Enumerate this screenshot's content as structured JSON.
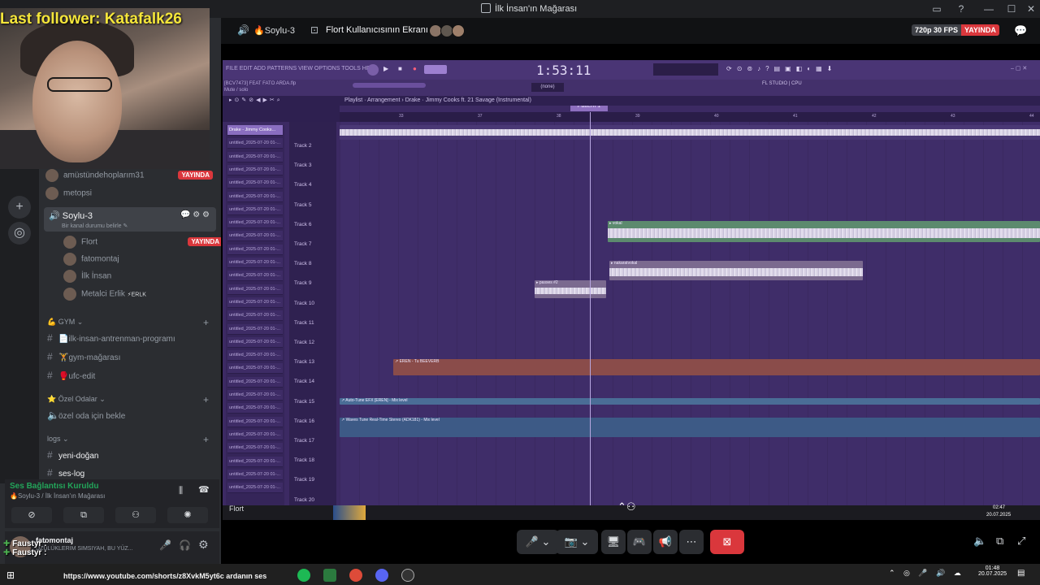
{
  "window": {
    "title": "İlk İnsan'ın Mağarası",
    "buttons": [
      "▭",
      "?",
      "—",
      "☐",
      "✕"
    ]
  },
  "overlay": {
    "last_follower": "Last follower: Katafalk26",
    "chat_lines": [
      "Faustyr : ",
      "Faustyr : "
    ]
  },
  "voice_channel": {
    "members_top": [
      {
        "name": "amüstündehoplarım31",
        "live": "YAYINDA"
      },
      {
        "name": "metopsi",
        "live": ""
      }
    ],
    "channel_name": "🔊 Soylu-3",
    "channel_status": "Bir kanal durumu belirle ✎",
    "members": [
      {
        "name": "Flort",
        "live": "YAYINDA"
      },
      {
        "name": "fatomontaj",
        "live": ""
      },
      {
        "name": "İlk İnsan",
        "live": ""
      },
      {
        "name": "Metalci Erlik",
        "tag": "⚡ERLK",
        "live": ""
      }
    ]
  },
  "categories": {
    "gym": "💪 GYM ⌄",
    "gym_channels": [
      "📄ilk-insan-antrenman-programı",
      "🏋gym-mağarası",
      "🥊ufc-edit"
    ],
    "private": "⭐ Özel Odalar ⌄",
    "private_channels": [
      "özel oda için bekle"
    ],
    "logs": "logs ⌄",
    "logs_channels": [
      "yeni-doğan",
      "ses-log"
    ]
  },
  "voice_status": {
    "connected": "Ses Bağlantısı Kuruldu",
    "location": "🔥Soylu-3 / İlk İnsan'ın Mağarası"
  },
  "user_panel": {
    "name": "fatomontaj",
    "status": "ÜZÜLÜKLERIM SIMSIYAH, BU YÜZ..."
  },
  "stream_header": {
    "channel": "🔥Soylu-3",
    "share": "Flort Kullanıcısının Ekranı",
    "quality": "720p 30 FPS",
    "live": "YAYINDA"
  },
  "fl_studio": {
    "menu": "FILE  EDIT  ADD  PATTERNS  VIEW  OPTIONS  TOOLS  HELP",
    "time": "1:53:11",
    "project": "[BCV7473] FEAT FATO ARDA.flp",
    "project_sub": "Mute / solo",
    "pattern": "Pattern 1",
    "cpu": "FL STUDIO | CPU",
    "breadcrumb": "Playlist · Arrangement › Drake · Jimmy Cooks ft. 21 Savage (Instrumental)",
    "browser_first": "Drake - Jimmy Cooks...",
    "browser_item": "untitled_2025-07-20 01-...",
    "tracks": [
      "Track 2",
      "Track 3",
      "Track 4",
      "Track 5",
      "Track 6",
      "Track 7",
      "Track 8",
      "Track 9",
      "Track 10",
      "Track 11",
      "Track 12",
      "Track 13",
      "Track 14",
      "Track 15",
      "Track 16",
      "Track 17",
      "Track 18",
      "Track 19",
      "Track 20"
    ],
    "ruler": [
      "33",
      "37",
      "38",
      "39",
      "40",
      "41",
      "42",
      "43",
      "44"
    ],
    "clips": {
      "vokal": "▸ vokal",
      "nakarat": "▸ nakaratvokal",
      "vibes": "▸ passes #2",
      "fx1": "↗ EREN - Tu BEEVERB",
      "fx2": "↗ Auto-Tune EFX [EREN] - Mix level",
      "fx3": "↗ Waves Tune Real-Time Stereo (ADK181) - Mix level"
    }
  },
  "inner_taskbar": {
    "app": "Flort",
    "time": "02:47",
    "date": "20.07.2025"
  },
  "call_controls": [
    "🎤",
    "⌄",
    "📷",
    "⌄",
    "🖥",
    "🎮",
    "📢",
    "⋯"
  ],
  "taskbar": {
    "youtube": "https://www.youtube.com/shorts/z8XvkM5yt6c ardanın ses",
    "time": "01:48",
    "date": "20.07.2025"
  }
}
